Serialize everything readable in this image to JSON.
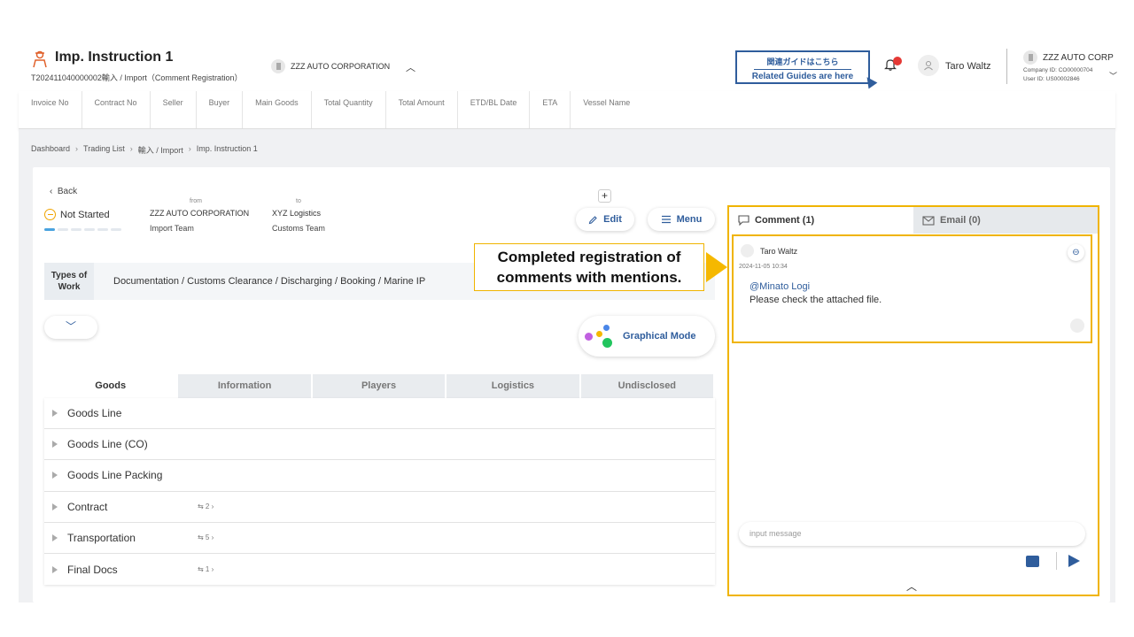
{
  "header": {
    "title": "Imp. Instruction 1",
    "subtitle": "T202411040000002輸入 / Import（Comment Registration）",
    "corporation": "ZZZ AUTO CORPORATION",
    "guide_jp": "関連ガイドはこちら",
    "guide_en": "Related Guides are here",
    "user_name": "Taro Waltz",
    "corp_short": "ZZZ AUTO CORP",
    "company_id": "Company ID: CO00000704",
    "user_id": "User ID: US00002846"
  },
  "columns": [
    "Invoice No",
    "Contract No",
    "Seller",
    "Buyer",
    "Main Goods",
    "Total Quantity",
    "Total Amount",
    "ETD/BL Date",
    "ETA",
    "Vessel Name"
  ],
  "breadcrumb": [
    "Dashboard",
    "Trading List",
    "輸入 / Import",
    "Imp. Instruction 1"
  ],
  "detail": {
    "back_label": "Back",
    "status": "Not Started",
    "from_label": "from",
    "to_label": "to",
    "from_corp": "ZZZ AUTO CORPORATION",
    "from_team": "Import Team",
    "to_corp": "XYZ Logistics",
    "to_team": "Customs Team",
    "edit_label": "Edit",
    "menu_label": "Menu",
    "types_label_1": "Types of",
    "types_label_2": "Work",
    "types_value": "Documentation / Customs Clearance / Discharging / Booking / Marine IP",
    "graphical_label": "Graphical Mode"
  },
  "callout": {
    "line1": "Completed registration of",
    "line2": "comments with mentions."
  },
  "tabs": [
    "Goods",
    "Information",
    "Players",
    "Logistics",
    "Undisclosed"
  ],
  "rows": [
    {
      "label": "Goods Line",
      "count": ""
    },
    {
      "label": "Goods Line (CO)",
      "count": ""
    },
    {
      "label": "Goods Line Packing",
      "count": ""
    },
    {
      "label": "Contract",
      "count": "⇆ 2 ›"
    },
    {
      "label": "Transportation",
      "count": "⇆ 5 ›"
    },
    {
      "label": "Final Docs",
      "count": "⇆ 1 ›"
    }
  ],
  "comments": {
    "tab_comment": "Comment (1)",
    "tab_email": "Email (0)",
    "author": "Taro Waltz",
    "time": "2024-11-05 10:34",
    "mention": "@Minato Logi",
    "text": "Please check the attached file.",
    "input_placeholder": "input message"
  },
  "colors": {
    "accent": "#2f5d9c",
    "highlight": "#f0b400",
    "notification": "#e53935"
  }
}
